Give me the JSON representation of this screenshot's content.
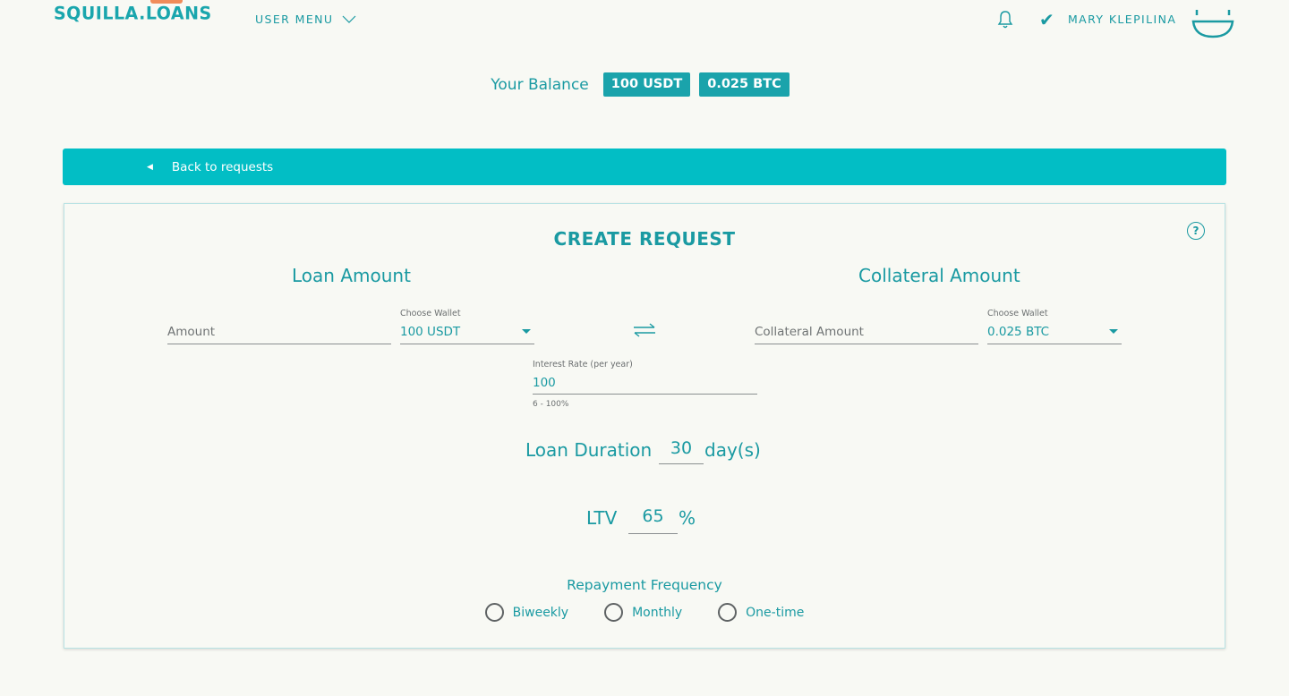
{
  "header": {
    "logo": "SQUILLA.LOANS",
    "user_menu_label": "USER MENU",
    "username": "MARY KLEPILINA"
  },
  "balance": {
    "label": "Your Balance",
    "chips": [
      "100 USDT",
      "0.025 BTC"
    ]
  },
  "back_bar": {
    "label": "Back to requests"
  },
  "form": {
    "title": "CREATE REQUEST",
    "help": "?",
    "loan_amount": {
      "title": "Loan Amount",
      "amount_placeholder": "Amount",
      "wallet_label": "Choose Wallet",
      "wallet_value": "100 USDT"
    },
    "collateral_amount": {
      "title": "Collateral Amount",
      "amount_placeholder": "Collateral Amount",
      "wallet_label": "Choose Wallet",
      "wallet_value": "0.025 BTC"
    },
    "interest_rate": {
      "label": "Interest Rate (per year)",
      "value": "100",
      "hint": "6 - 100%"
    },
    "loan_duration": {
      "label": "Loan Duration",
      "value": "30",
      "unit": "day(s)"
    },
    "ltv": {
      "label": "LTV",
      "value": "65",
      "unit": "%"
    },
    "repayment": {
      "title": "Repayment Frequency",
      "options": [
        "Biweekly",
        "Monthly",
        "One-time"
      ]
    }
  },
  "colors": {
    "accent": "#1a9aa2",
    "bar": "#02bec5",
    "background": "#f8f9f4"
  }
}
